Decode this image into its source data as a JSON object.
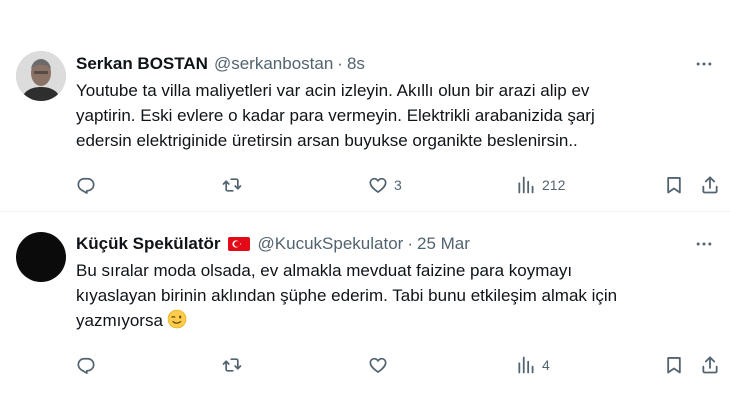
{
  "tweets": [
    {
      "name": "Serkan BOSTAN",
      "handle": "@serkanbostan",
      "separator": "·",
      "time": "8s",
      "text_lines": [
        "Youtube ta villa maliyetleri var acin izleyin. Akıllı olun bir arazi alip ev",
        "yaptirin. Eski evlere o kadar para vermeyin. Elektrikli arabanizida şarj",
        "edersin elektriginide üretirsin arsan buyukse organikte beslenirsin.."
      ],
      "emoji": "",
      "likes": "3",
      "views": "212",
      "icons": {
        "more": "more-dots-icon",
        "reply": "reply-icon",
        "retweet": "retweet-icon",
        "like": "heart-icon",
        "views": "views-chart-icon",
        "bookmark": "bookmark-icon",
        "share": "share-icon"
      }
    },
    {
      "name": "Küçük Spekülatör",
      "flag": "turkey-flag-icon",
      "handle": "@KucukSpekulator",
      "separator": "·",
      "time": "25 Mar",
      "text_lines": [
        "Bu sıralar moda olsada, ev almakla mevduat faizine para koymayı",
        "kıyaslayan birinin aklından şüphe ederim. Tabi bunu etkileşim almak için",
        "yazmıyorsa"
      ],
      "emoji": "winking-face-icon",
      "likes": "",
      "views": "4",
      "icons": {
        "more": "more-dots-icon",
        "reply": "reply-icon",
        "retweet": "retweet-icon",
        "like": "heart-icon",
        "views": "views-chart-icon",
        "bookmark": "bookmark-icon",
        "share": "share-icon"
      }
    }
  ],
  "colors": {
    "text": "#0f1419",
    "secondary": "#536471",
    "divider": "#eff3f4",
    "flag_red": "#e30a17"
  }
}
